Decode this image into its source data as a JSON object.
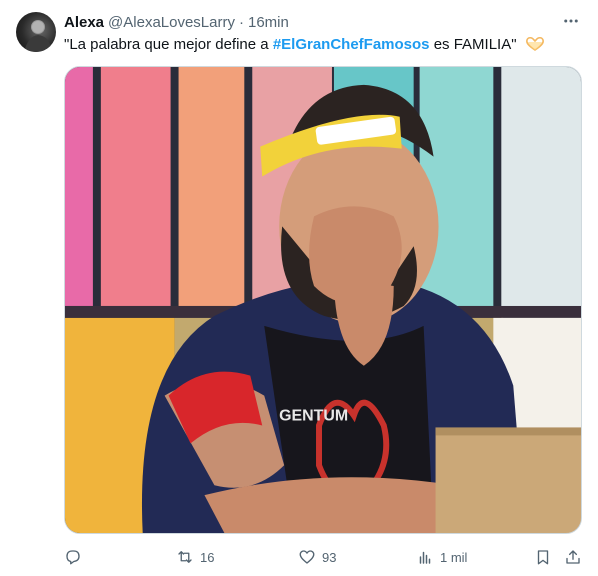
{
  "tweet": {
    "author_name": "Alexa",
    "author_handle": "@AlexaLovesLarry",
    "separator": "·",
    "time": "16min",
    "text_before": "\"La palabra que mejor define a ",
    "hashtag": "#ElGranChefFamosos",
    "text_after": " es FAMILIA\"",
    "emoji": "heart-hands-icon",
    "media_overlay_text": "GENTUM"
  },
  "actions": {
    "reply": {
      "icon": "reply-icon",
      "count": ""
    },
    "retweet": {
      "icon": "retweet-icon",
      "count": "16"
    },
    "like": {
      "icon": "heart-icon",
      "count": "93"
    },
    "views": {
      "icon": "views-icon",
      "count": "1 mil"
    },
    "bookmark": {
      "icon": "bookmark-icon"
    },
    "share": {
      "icon": "share-icon"
    }
  },
  "colors": {
    "accent": "#1d9bf0",
    "secondary_text": "#536471",
    "border": "#cfd9de"
  }
}
